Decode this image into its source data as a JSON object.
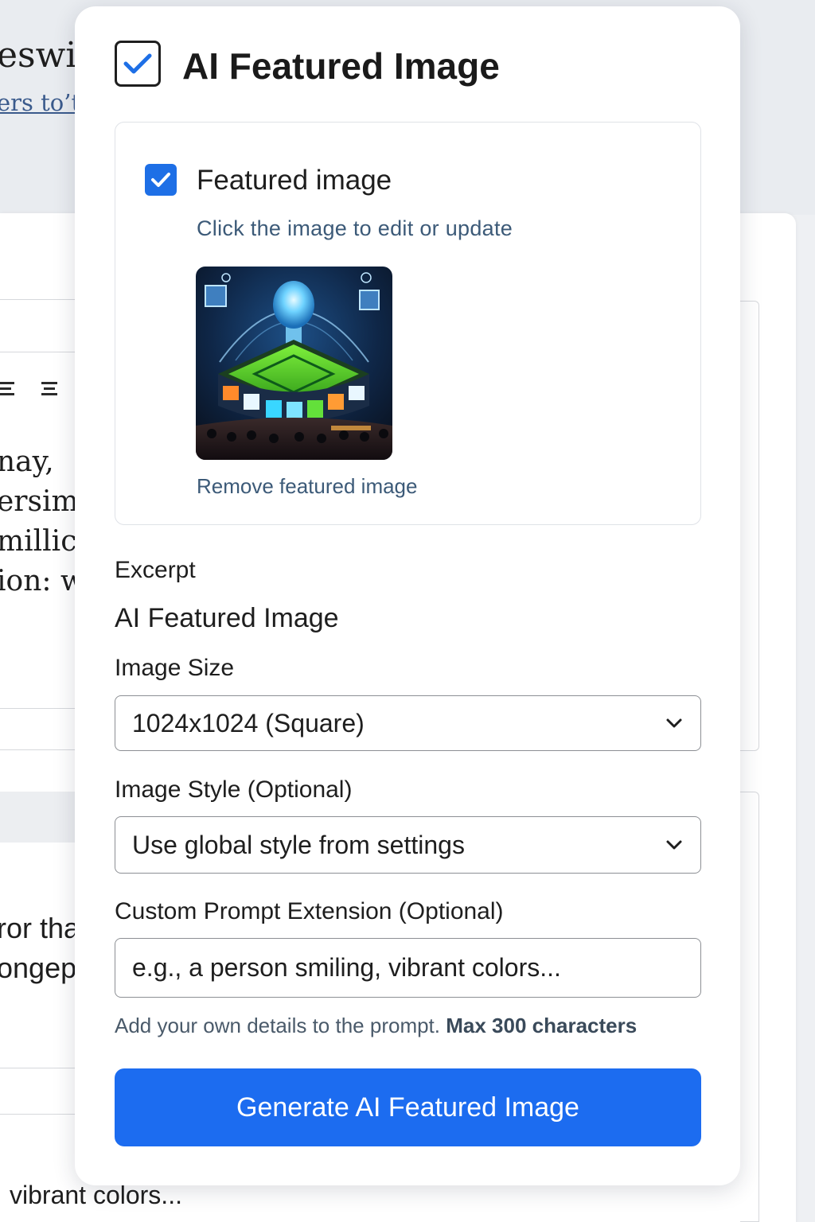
{
  "background": {
    "title_fragment": "eswit",
    "subtitle_fragment": "ers to’t",
    "text_lines": [
      "nay,",
      "ersimu",
      "millic",
      "ion: w",
      "ror tha",
      "ongep"
    ],
    "bottom_text": "vibrant colors..."
  },
  "panel": {
    "title": "AI Featured Image",
    "header_checked": true
  },
  "featured_image": {
    "label": "Featured image",
    "checked": true,
    "hint": "Click the image to edit or update",
    "remove_label": "Remove featured image"
  },
  "excerpt_label": "Excerpt",
  "section_title": "AI Featured Image",
  "image_size": {
    "label": "Image Size",
    "selected": "1024x1024 (Square)"
  },
  "image_style": {
    "label": "Image Style (Optional)",
    "selected": "Use global style from settings"
  },
  "custom_prompt": {
    "label": "Custom Prompt Extension (Optional)",
    "placeholder": "e.g., a person smiling, vibrant colors...",
    "help_prefix": "Add your own details to the prompt.",
    "help_limit": "Max 300 characters"
  },
  "generate_button": {
    "label": "Generate AI Featured Image"
  },
  "colors": {
    "accent": "#1c6cf0",
    "checkbox": "#1e6fe6",
    "hint_text": "#3c5a78"
  },
  "icons": [
    "checkbox-check-icon",
    "chevron-down-icon",
    "align-left-icon",
    "align-center-icon"
  ]
}
